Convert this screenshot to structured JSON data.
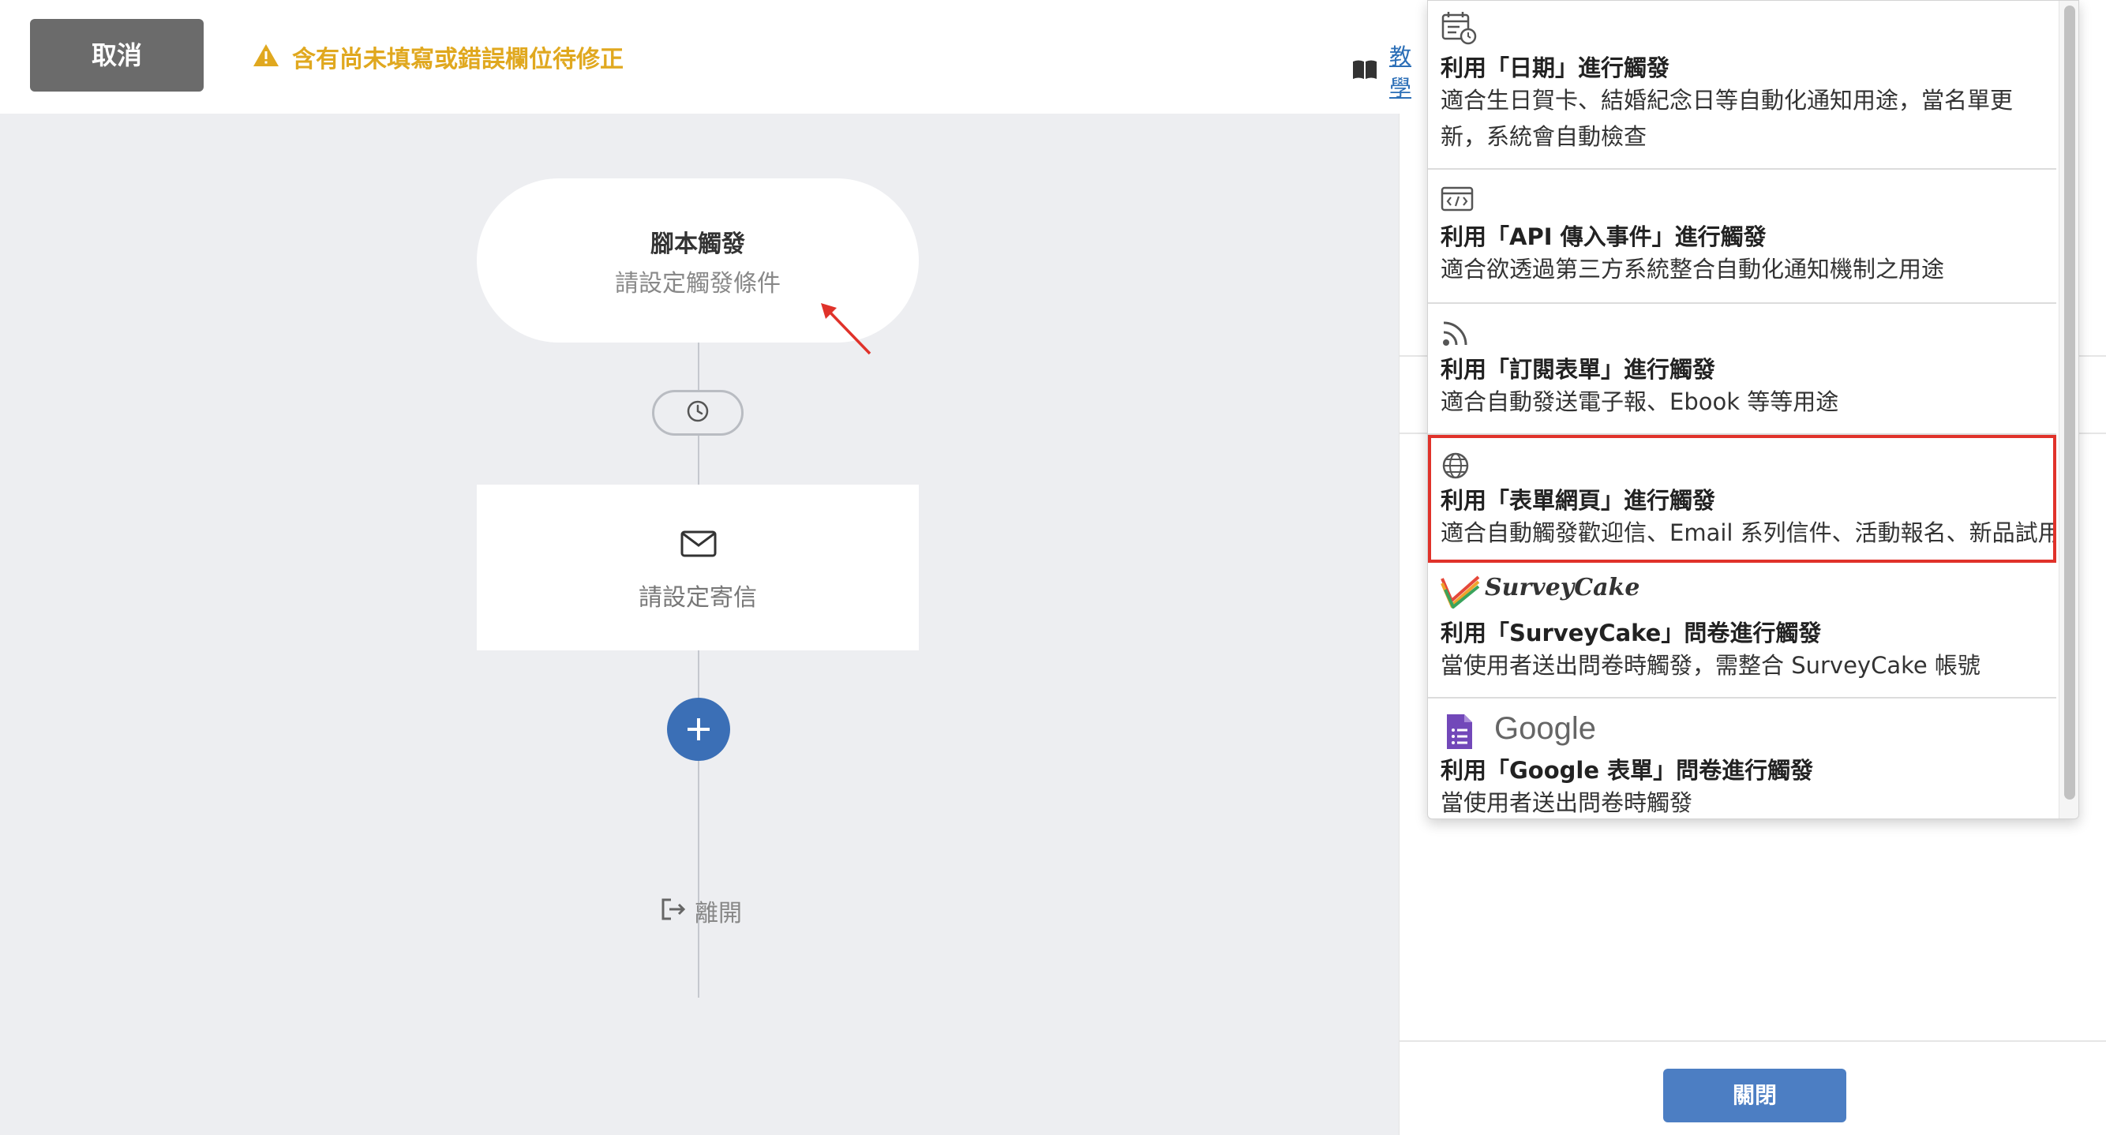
{
  "topbar": {
    "cancel_label": "取消",
    "warning_text": "含有尚未填寫或錯誤欄位待修正",
    "tutorial_label": "教學"
  },
  "flow": {
    "trigger_title": "腳本觸發",
    "trigger_subtitle": "請設定觸發條件",
    "mail_label": "請設定寄信",
    "exit_label": "離開"
  },
  "dropdown": {
    "options": [
      {
        "icon": "calendar-clock-icon",
        "title": "利用「日期」進行觸發",
        "desc": [
          "適合生日賀卡、結婚紀念日等自動化通知用途，當名單更",
          "新，系統會自動檢查"
        ]
      },
      {
        "icon": "api-code-icon",
        "title": "利用「API 傳入事件」進行觸發",
        "desc": [
          "適合欲透過第三方系統整合自動化通知機制之用途"
        ]
      },
      {
        "icon": "rss-icon",
        "title": "利用「訂閱表單」進行觸發",
        "desc": [
          "適合自動發送電子報、Ebook 等等用途"
        ]
      },
      {
        "icon": "globe-icon",
        "title": "利用「表單網頁」進行觸發",
        "desc": [
          "適合自動觸發歡迎信、Email 系列信件、活動報名、新品試用"
        ],
        "selected": true
      },
      {
        "icon": "surveycake-logo-icon",
        "brand": "SurveyCake",
        "title": "利用「SurveyCake」問卷進行觸發",
        "desc": [
          "當使用者送出問卷時觸發，需整合 SurveyCake 帳號"
        ]
      },
      {
        "icon": "google-forms-icon",
        "brand": "Google",
        "title": "利用「Google 表單」問卷進行觸發",
        "desc": [
          "當使用者送出問卷時觸發"
        ]
      }
    ]
  },
  "panel": {
    "close_label": "關閉"
  },
  "colors": {
    "warning": "#e0a81f",
    "primary": "#3b6fb6",
    "selected_border": "#e0322a",
    "annotation_arrow": "#e0322a"
  }
}
